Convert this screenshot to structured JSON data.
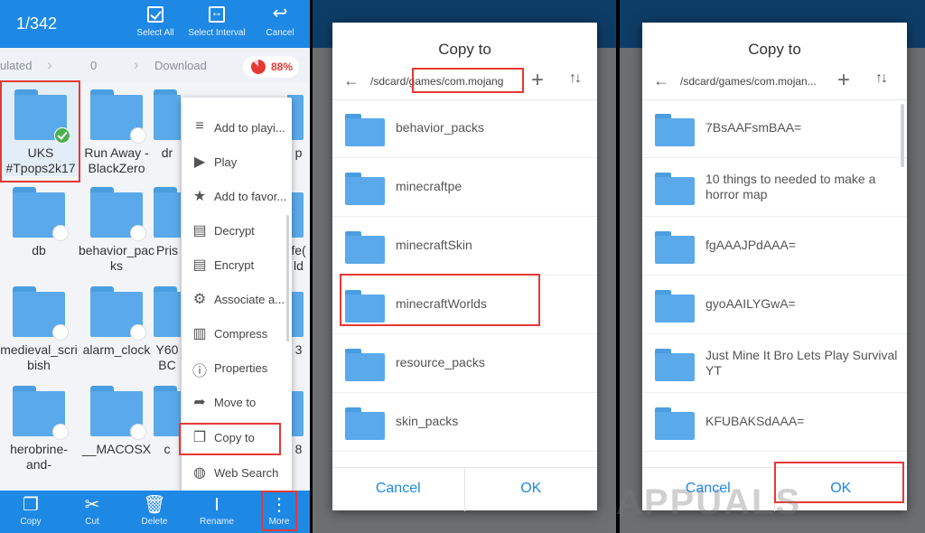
{
  "panel1": {
    "counter": "1/342",
    "actions": [
      {
        "label": "Select All",
        "icon": "select-all-icon"
      },
      {
        "label": "Select Interval",
        "icon": "select-interval-icon"
      },
      {
        "label": "Cancel",
        "icon": "undo-icon"
      }
    ],
    "breadcrumb": [
      "ulated",
      "0",
      "Download"
    ],
    "storage_percent": "88%",
    "files": [
      {
        "name": "UKS #Tpops2k17",
        "selected": true
      },
      {
        "name": "Run Away - BlackZero"
      },
      {
        "name": "dr"
      },
      {
        "name": "p"
      },
      {
        "name": "db"
      },
      {
        "name": "behavior_packs"
      },
      {
        "name": "Pris"
      },
      {
        "name": "fe( ld"
      },
      {
        "name": "medieval_scribish"
      },
      {
        "name": "alarm_clock"
      },
      {
        "name": "Y60 BC"
      },
      {
        "name": "3"
      },
      {
        "name": "herobrine-and-"
      },
      {
        "name": "__MACOSX"
      },
      {
        "name": "c"
      },
      {
        "name": "8"
      }
    ],
    "menu": [
      {
        "label": "Add to playi...",
        "icon": "playlist-add-icon"
      },
      {
        "label": "Play",
        "icon": "play-icon"
      },
      {
        "label": "Add to favor...",
        "icon": "star-icon"
      },
      {
        "label": "Decrypt",
        "icon": "decrypt-icon"
      },
      {
        "label": "Encrypt",
        "icon": "encrypt-icon"
      },
      {
        "label": "Associate a...",
        "icon": "associate-icon"
      },
      {
        "label": "Compress",
        "icon": "compress-icon"
      },
      {
        "label": "Properties",
        "icon": "info-icon"
      },
      {
        "label": "Move to",
        "icon": "move-arrow-icon"
      },
      {
        "label": "Copy to",
        "icon": "copy-icon"
      },
      {
        "label": "Web Search",
        "icon": "web-search-icon"
      }
    ],
    "bottom": [
      {
        "label": "Copy",
        "icon": "copy-icon"
      },
      {
        "label": "Cut",
        "icon": "scissors-icon"
      },
      {
        "label": "Delete",
        "icon": "trash-icon"
      },
      {
        "label": "Rename",
        "icon": "rename-icon"
      },
      {
        "label": "More",
        "icon": "more-vertical-icon"
      }
    ]
  },
  "panel2": {
    "title": "Copy to",
    "path": "/sdcard/games/com.mojang",
    "folders": [
      "behavior_packs",
      "minecraftpe",
      "minecraftSkin",
      "minecraftWorlds",
      "resource_packs",
      "skin_packs"
    ],
    "cancel": "Cancel",
    "ok": "OK"
  },
  "panel3": {
    "title": "Copy to",
    "path": "/sdcard/games/com.mojan...",
    "folders": [
      "7BsAAFsmBAA=",
      "10 things to needed to make a horror map",
      "fgAAAJPdAAA=",
      "gyoAAILYGwA=",
      "Just Mine It Bro Lets Play Survival YT",
      "KFUBAKSdAAA="
    ],
    "cancel": "Cancel",
    "ok": "OK"
  },
  "watermark": "APPUALS"
}
